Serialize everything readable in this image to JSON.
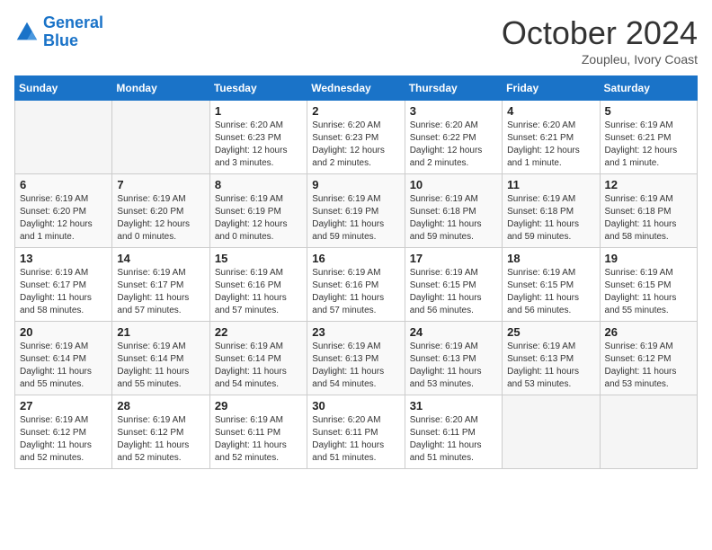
{
  "header": {
    "logo_line1": "General",
    "logo_line2": "Blue",
    "month": "October 2024",
    "location": "Zoupleu, Ivory Coast"
  },
  "days_of_week": [
    "Sunday",
    "Monday",
    "Tuesday",
    "Wednesday",
    "Thursday",
    "Friday",
    "Saturday"
  ],
  "weeks": [
    [
      {
        "day": "",
        "info": ""
      },
      {
        "day": "",
        "info": ""
      },
      {
        "day": "1",
        "info": "Sunrise: 6:20 AM\nSunset: 6:23 PM\nDaylight: 12 hours and 3 minutes."
      },
      {
        "day": "2",
        "info": "Sunrise: 6:20 AM\nSunset: 6:23 PM\nDaylight: 12 hours and 2 minutes."
      },
      {
        "day": "3",
        "info": "Sunrise: 6:20 AM\nSunset: 6:22 PM\nDaylight: 12 hours and 2 minutes."
      },
      {
        "day": "4",
        "info": "Sunrise: 6:20 AM\nSunset: 6:21 PM\nDaylight: 12 hours and 1 minute."
      },
      {
        "day": "5",
        "info": "Sunrise: 6:19 AM\nSunset: 6:21 PM\nDaylight: 12 hours and 1 minute."
      }
    ],
    [
      {
        "day": "6",
        "info": "Sunrise: 6:19 AM\nSunset: 6:20 PM\nDaylight: 12 hours and 1 minute."
      },
      {
        "day": "7",
        "info": "Sunrise: 6:19 AM\nSunset: 6:20 PM\nDaylight: 12 hours and 0 minutes."
      },
      {
        "day": "8",
        "info": "Sunrise: 6:19 AM\nSunset: 6:19 PM\nDaylight: 12 hours and 0 minutes."
      },
      {
        "day": "9",
        "info": "Sunrise: 6:19 AM\nSunset: 6:19 PM\nDaylight: 11 hours and 59 minutes."
      },
      {
        "day": "10",
        "info": "Sunrise: 6:19 AM\nSunset: 6:18 PM\nDaylight: 11 hours and 59 minutes."
      },
      {
        "day": "11",
        "info": "Sunrise: 6:19 AM\nSunset: 6:18 PM\nDaylight: 11 hours and 59 minutes."
      },
      {
        "day": "12",
        "info": "Sunrise: 6:19 AM\nSunset: 6:18 PM\nDaylight: 11 hours and 58 minutes."
      }
    ],
    [
      {
        "day": "13",
        "info": "Sunrise: 6:19 AM\nSunset: 6:17 PM\nDaylight: 11 hours and 58 minutes."
      },
      {
        "day": "14",
        "info": "Sunrise: 6:19 AM\nSunset: 6:17 PM\nDaylight: 11 hours and 57 minutes."
      },
      {
        "day": "15",
        "info": "Sunrise: 6:19 AM\nSunset: 6:16 PM\nDaylight: 11 hours and 57 minutes."
      },
      {
        "day": "16",
        "info": "Sunrise: 6:19 AM\nSunset: 6:16 PM\nDaylight: 11 hours and 57 minutes."
      },
      {
        "day": "17",
        "info": "Sunrise: 6:19 AM\nSunset: 6:15 PM\nDaylight: 11 hours and 56 minutes."
      },
      {
        "day": "18",
        "info": "Sunrise: 6:19 AM\nSunset: 6:15 PM\nDaylight: 11 hours and 56 minutes."
      },
      {
        "day": "19",
        "info": "Sunrise: 6:19 AM\nSunset: 6:15 PM\nDaylight: 11 hours and 55 minutes."
      }
    ],
    [
      {
        "day": "20",
        "info": "Sunrise: 6:19 AM\nSunset: 6:14 PM\nDaylight: 11 hours and 55 minutes."
      },
      {
        "day": "21",
        "info": "Sunrise: 6:19 AM\nSunset: 6:14 PM\nDaylight: 11 hours and 55 minutes."
      },
      {
        "day": "22",
        "info": "Sunrise: 6:19 AM\nSunset: 6:14 PM\nDaylight: 11 hours and 54 minutes."
      },
      {
        "day": "23",
        "info": "Sunrise: 6:19 AM\nSunset: 6:13 PM\nDaylight: 11 hours and 54 minutes."
      },
      {
        "day": "24",
        "info": "Sunrise: 6:19 AM\nSunset: 6:13 PM\nDaylight: 11 hours and 53 minutes."
      },
      {
        "day": "25",
        "info": "Sunrise: 6:19 AM\nSunset: 6:13 PM\nDaylight: 11 hours and 53 minutes."
      },
      {
        "day": "26",
        "info": "Sunrise: 6:19 AM\nSunset: 6:12 PM\nDaylight: 11 hours and 53 minutes."
      }
    ],
    [
      {
        "day": "27",
        "info": "Sunrise: 6:19 AM\nSunset: 6:12 PM\nDaylight: 11 hours and 52 minutes."
      },
      {
        "day": "28",
        "info": "Sunrise: 6:19 AM\nSunset: 6:12 PM\nDaylight: 11 hours and 52 minutes."
      },
      {
        "day": "29",
        "info": "Sunrise: 6:19 AM\nSunset: 6:11 PM\nDaylight: 11 hours and 52 minutes."
      },
      {
        "day": "30",
        "info": "Sunrise: 6:20 AM\nSunset: 6:11 PM\nDaylight: 11 hours and 51 minutes."
      },
      {
        "day": "31",
        "info": "Sunrise: 6:20 AM\nSunset: 6:11 PM\nDaylight: 11 hours and 51 minutes."
      },
      {
        "day": "",
        "info": ""
      },
      {
        "day": "",
        "info": ""
      }
    ]
  ]
}
